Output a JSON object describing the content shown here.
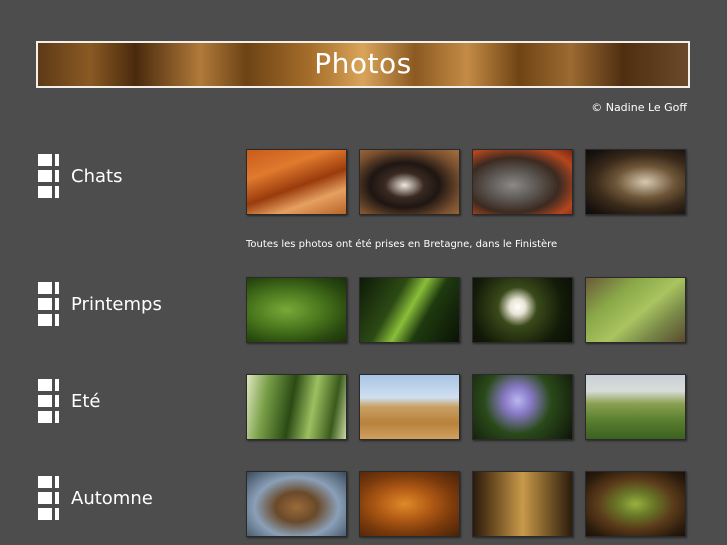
{
  "header": {
    "title": "Photos",
    "copyright": "©  Nadine Le Goff"
  },
  "note": "Toutes les photos ont été prises en Bretagne, dans le Finistère",
  "sections": [
    {
      "label": "Chats",
      "thumbs": [
        {
          "name": "curtain-photo",
          "bg": "linear-gradient(160deg,#c85a1a 0%,#e07a2e 30%,#9a3b0c 55%,#e6a060 75%,#b86528 100%)"
        },
        {
          "name": "cat-lying-photo",
          "bg": "radial-gradient(ellipse at 45% 55%,#f0e8e0 0%,#3a2a22 25%,#1e1612 45%,#7a5030 75%,#a5703c 100%)"
        },
        {
          "name": "cat-looking-up-photo",
          "bg": "radial-gradient(ellipse at 40% 55%,#8a8a88 0%,#5b5652 30%,#3c2a20 55%,#b4461e 80%,#7c2410 100%)"
        },
        {
          "name": "cat-closeup-photo",
          "bg": "radial-gradient(ellipse at 60% 50%,#d8c8b0 0%,#6e5638 35%,#3a2a1a 60%,#1a1410 85%,#0c0a08 100%)"
        }
      ]
    },
    {
      "label": "Printemps",
      "thumbs": [
        {
          "name": "grass-photo",
          "bg": "radial-gradient(ellipse at 40% 50%,#7aa83a 0%,#4c7a1e 40%,#2a4a10 75%,#1b300a 100%)"
        },
        {
          "name": "grass-blade-photo",
          "bg": "linear-gradient(120deg,#0e1a08 0%,#2c4a14 35%,#8abe3a 50%,#1e3a0e 65%,#0a1206 100%)"
        },
        {
          "name": "daisies-photo",
          "bg": "radial-gradient(circle at 45% 45%,#ffffff 0%,#e8e4d4 12%,#3a4a1a 30%,#121a08 70%,#0a0e06 100%)"
        },
        {
          "name": "moss-stone-photo",
          "bg": "linear-gradient(140deg,#6a5a3a 0%,#8aa848 30%,#a9c460 55%,#7a8a48 75%,#5a4a30 100%)"
        }
      ]
    },
    {
      "label": "Eté",
      "thumbs": [
        {
          "name": "corn-field-photo",
          "bg": "linear-gradient(100deg,#dfe8c0 0%,#7aa048 20%,#2a4a14 45%,#9cc060 65%,#3a5a1c 85%,#c8d8a0 100%)"
        },
        {
          "name": "hay-bale-photo",
          "bg": "linear-gradient(180deg,#a8c4e4 0%,#cfdff0 35%,#c8a062 50%,#b8823c 75%,#d0a060 100%)"
        },
        {
          "name": "flowers-photo",
          "bg": "radial-gradient(circle at 45% 40%,#b8b8ee 0%,#8a7ac8 20%,#2a4a1a 50%,#1a2a10 80%,#0e1408 100%)"
        },
        {
          "name": "countryside-photo",
          "bg": "linear-gradient(180deg,#c8d0d8 0%,#d8dcd8 25%,#8aa050 45%,#5a8030 70%,#3c6020 100%)"
        }
      ]
    },
    {
      "label": "Automne",
      "thumbs": [
        {
          "name": "frost-leaves-photo",
          "bg": "radial-gradient(ellipse at 50% 55%,#9a6a3a 0%,#6a4a2a 30%,#8aa0b8 60%,#3a4a5a 100%)"
        },
        {
          "name": "orange-leaves-photo",
          "bg": "radial-gradient(ellipse at 45% 50%,#e08a2a 0%,#b05a14 35%,#7a3a0c 65%,#4a2208 100%)"
        },
        {
          "name": "forest-path-photo",
          "bg": "linear-gradient(90deg,#2a1a0c 0%,#6a4a20 20%,#c89a4a 50%,#7a5a28 75%,#2a1c0c 100%)"
        },
        {
          "name": "chestnuts-photo",
          "bg": "radial-gradient(ellipse at 50% 50%,#9ab040 0%,#6a7a28 25%,#5a3a1a 55%,#2a1a0c 85%,#1a1008 100%)"
        }
      ]
    }
  ]
}
